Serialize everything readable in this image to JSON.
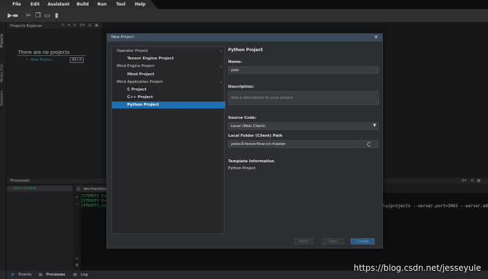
{
  "menubar": {
    "items": [
      "File",
      "Edit",
      "Assistant",
      "Build",
      "Run",
      "Tool",
      "Help"
    ]
  },
  "toolbar": {
    "icons": [
      "open-project-icon",
      "cut-icon",
      "copy-icon",
      "paste-icon",
      "delete-icon"
    ]
  },
  "rail": {
    "tabs": [
      "Projects",
      "Model Zoo",
      "Datasets"
    ]
  },
  "explorer": {
    "title": "Projects Explorer",
    "empty_message": "There are no projects",
    "new_project_link": "New Project...",
    "shortcut": "Alt+X"
  },
  "dialog": {
    "title": "New Project",
    "close_glyph": "✕",
    "tree": [
      {
        "label": "Operator Project",
        "kind": "category",
        "expanded": true
      },
      {
        "label": "Tensor Engine Project",
        "kind": "child"
      },
      {
        "label": "Mind Engine Project",
        "kind": "category",
        "expanded": true
      },
      {
        "label": "Mind Project",
        "kind": "child"
      },
      {
        "label": "Mind Application Project",
        "kind": "category",
        "expanded": true
      },
      {
        "label": "C Project",
        "kind": "child"
      },
      {
        "label": "C++ Project",
        "kind": "child"
      },
      {
        "label": "Python Project",
        "kind": "child",
        "selected": true
      }
    ],
    "form": {
      "heading": "Python Project",
      "name_label": "Name:",
      "name_value": "yolo",
      "description_label": "Description:",
      "description_placeholder": "Add a description to your project",
      "source_code_label": "Source Code:",
      "source_code_value": "Local (Web Client)",
      "local_folder_label": "Local Folder (Client) Path",
      "local_folder_value": "yolov3-tensorflow-cn-master",
      "template_label": "Template Information",
      "template_value": "Python Project"
    },
    "buttons": {
      "back": "Back",
      "next": "Next",
      "create": "Create"
    }
  },
  "processes": {
    "title": "Processes",
    "process_name": "dev-machine",
    "console_tab": "dev-machine",
    "stdout_lines": [
      "[STDOUT] Cu",
      "[STDOUT] Cu",
      "[STDOUT] ju"
    ],
    "command_tail": "ls/projects --server.port=3002 --server.ad"
  },
  "bottom_tabs": [
    "Events",
    "Processes",
    "Log"
  ],
  "watermark": "https://blog.csdn.net/jesseyule",
  "colors": {
    "accent": "#1f6fb0",
    "success": "#3fbf6c",
    "link": "#4aa3df"
  }
}
